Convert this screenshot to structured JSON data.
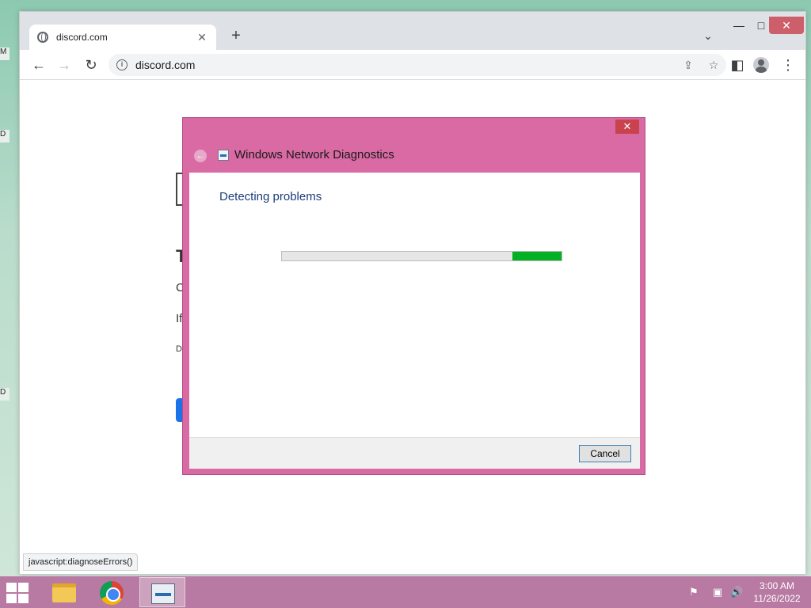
{
  "browser": {
    "tab_title": "discord.com",
    "tab_close": "✕",
    "new_tab": "+",
    "tab_search": "⌄",
    "window_controls": {
      "minimize": "—",
      "maximize": "□",
      "close": "✕"
    },
    "url": "discord.com",
    "status_text": "javascript:diagnoseErrors()",
    "icons": {
      "back": "←",
      "forward": "→",
      "reload": "↻",
      "share": "⇪",
      "bookmark": "☆",
      "side_panel": "◧",
      "menu": "⋮"
    }
  },
  "page_background": {
    "frag_t": "T",
    "frag_c": "C",
    "frag_if": "If",
    "frag_d": "D"
  },
  "dialog": {
    "title": "Windows Network Diagnostics",
    "close_label": "✕",
    "back_label": "←",
    "heading": "Detecting problems",
    "progress_segment": {
      "start": 0.825,
      "end": 1.0
    },
    "cancel_label": "Cancel"
  },
  "taskbar": {
    "clock_time": "3:00 AM",
    "clock_date": "11/26/2022",
    "tray_icons": [
      "flag-icon",
      "network-icon",
      "speaker-icon"
    ],
    "tray_glyphs": {
      "flag": "⚑",
      "network": "▣",
      "speaker": "🔊"
    },
    "apps": [
      "file-explorer-icon",
      "chrome-icon",
      "network-diagnostics-icon"
    ]
  },
  "desktop_edge": {
    "labels": [
      "M",
      "D",
      "D"
    ]
  },
  "colors": {
    "dialog_frame": "#d96aa4",
    "progress_fill": "#06b025",
    "taskbar": "#b87aa3"
  }
}
